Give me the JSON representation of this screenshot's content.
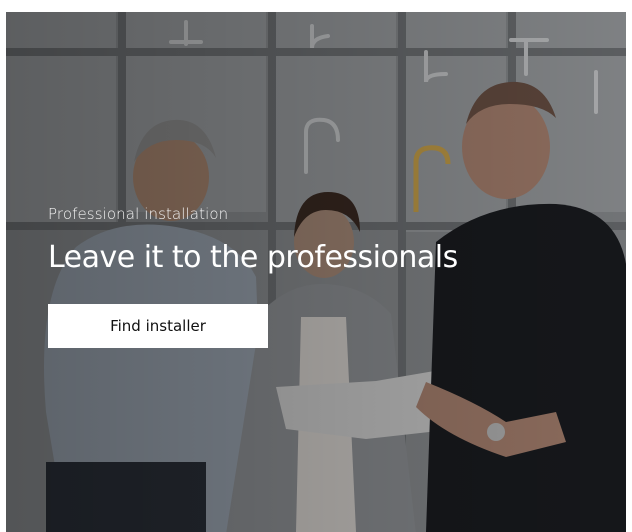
{
  "hero": {
    "eyebrow": "Professional installation",
    "headline": "Leave it to the professionals",
    "cta_label": "Find installer"
  },
  "colors": {
    "cta_background": "#ffffff",
    "cta_text": "#111111",
    "headline_text": "#ffffff"
  }
}
